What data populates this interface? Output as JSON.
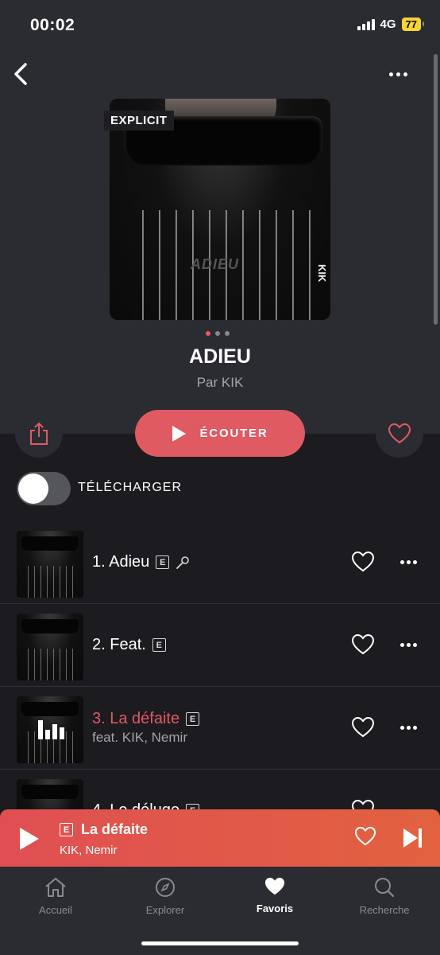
{
  "status_bar": {
    "time": "00:02",
    "network": "4G",
    "battery": "77"
  },
  "album": {
    "explicit_tag": "EXPLICIT",
    "cover_title": "ADIEU",
    "cover_artist": "KIK",
    "title": "ADIEU",
    "artist_line": "Par KIK"
  },
  "actions": {
    "listen_label": "ÉCOUTER",
    "download_label": "TÉLÉCHARGER"
  },
  "tracks": [
    {
      "title": "1. Adieu",
      "explicit": "E",
      "subtitle": ""
    },
    {
      "title": "2. Feat.",
      "explicit": "E",
      "subtitle": ""
    },
    {
      "title": "3. La défaite",
      "explicit": "E",
      "subtitle": "feat. KIK, Nemir"
    },
    {
      "title": "4. Le déluge",
      "explicit": "E",
      "subtitle": ""
    }
  ],
  "mini_player": {
    "explicit": "E",
    "title": "La défaite",
    "artists": "KIK, Nemir"
  },
  "tabs": [
    {
      "label": "Accueil",
      "icon": "home-icon"
    },
    {
      "label": "Explorer",
      "icon": "compass-icon"
    },
    {
      "label": "Favoris",
      "icon": "heart-icon"
    },
    {
      "label": "Recherche",
      "icon": "search-icon"
    }
  ],
  "colors": {
    "accent": "#e05a62",
    "battery": "#f7d435",
    "background_top": "#2b2b32",
    "background_list": "#1b1b20"
  }
}
